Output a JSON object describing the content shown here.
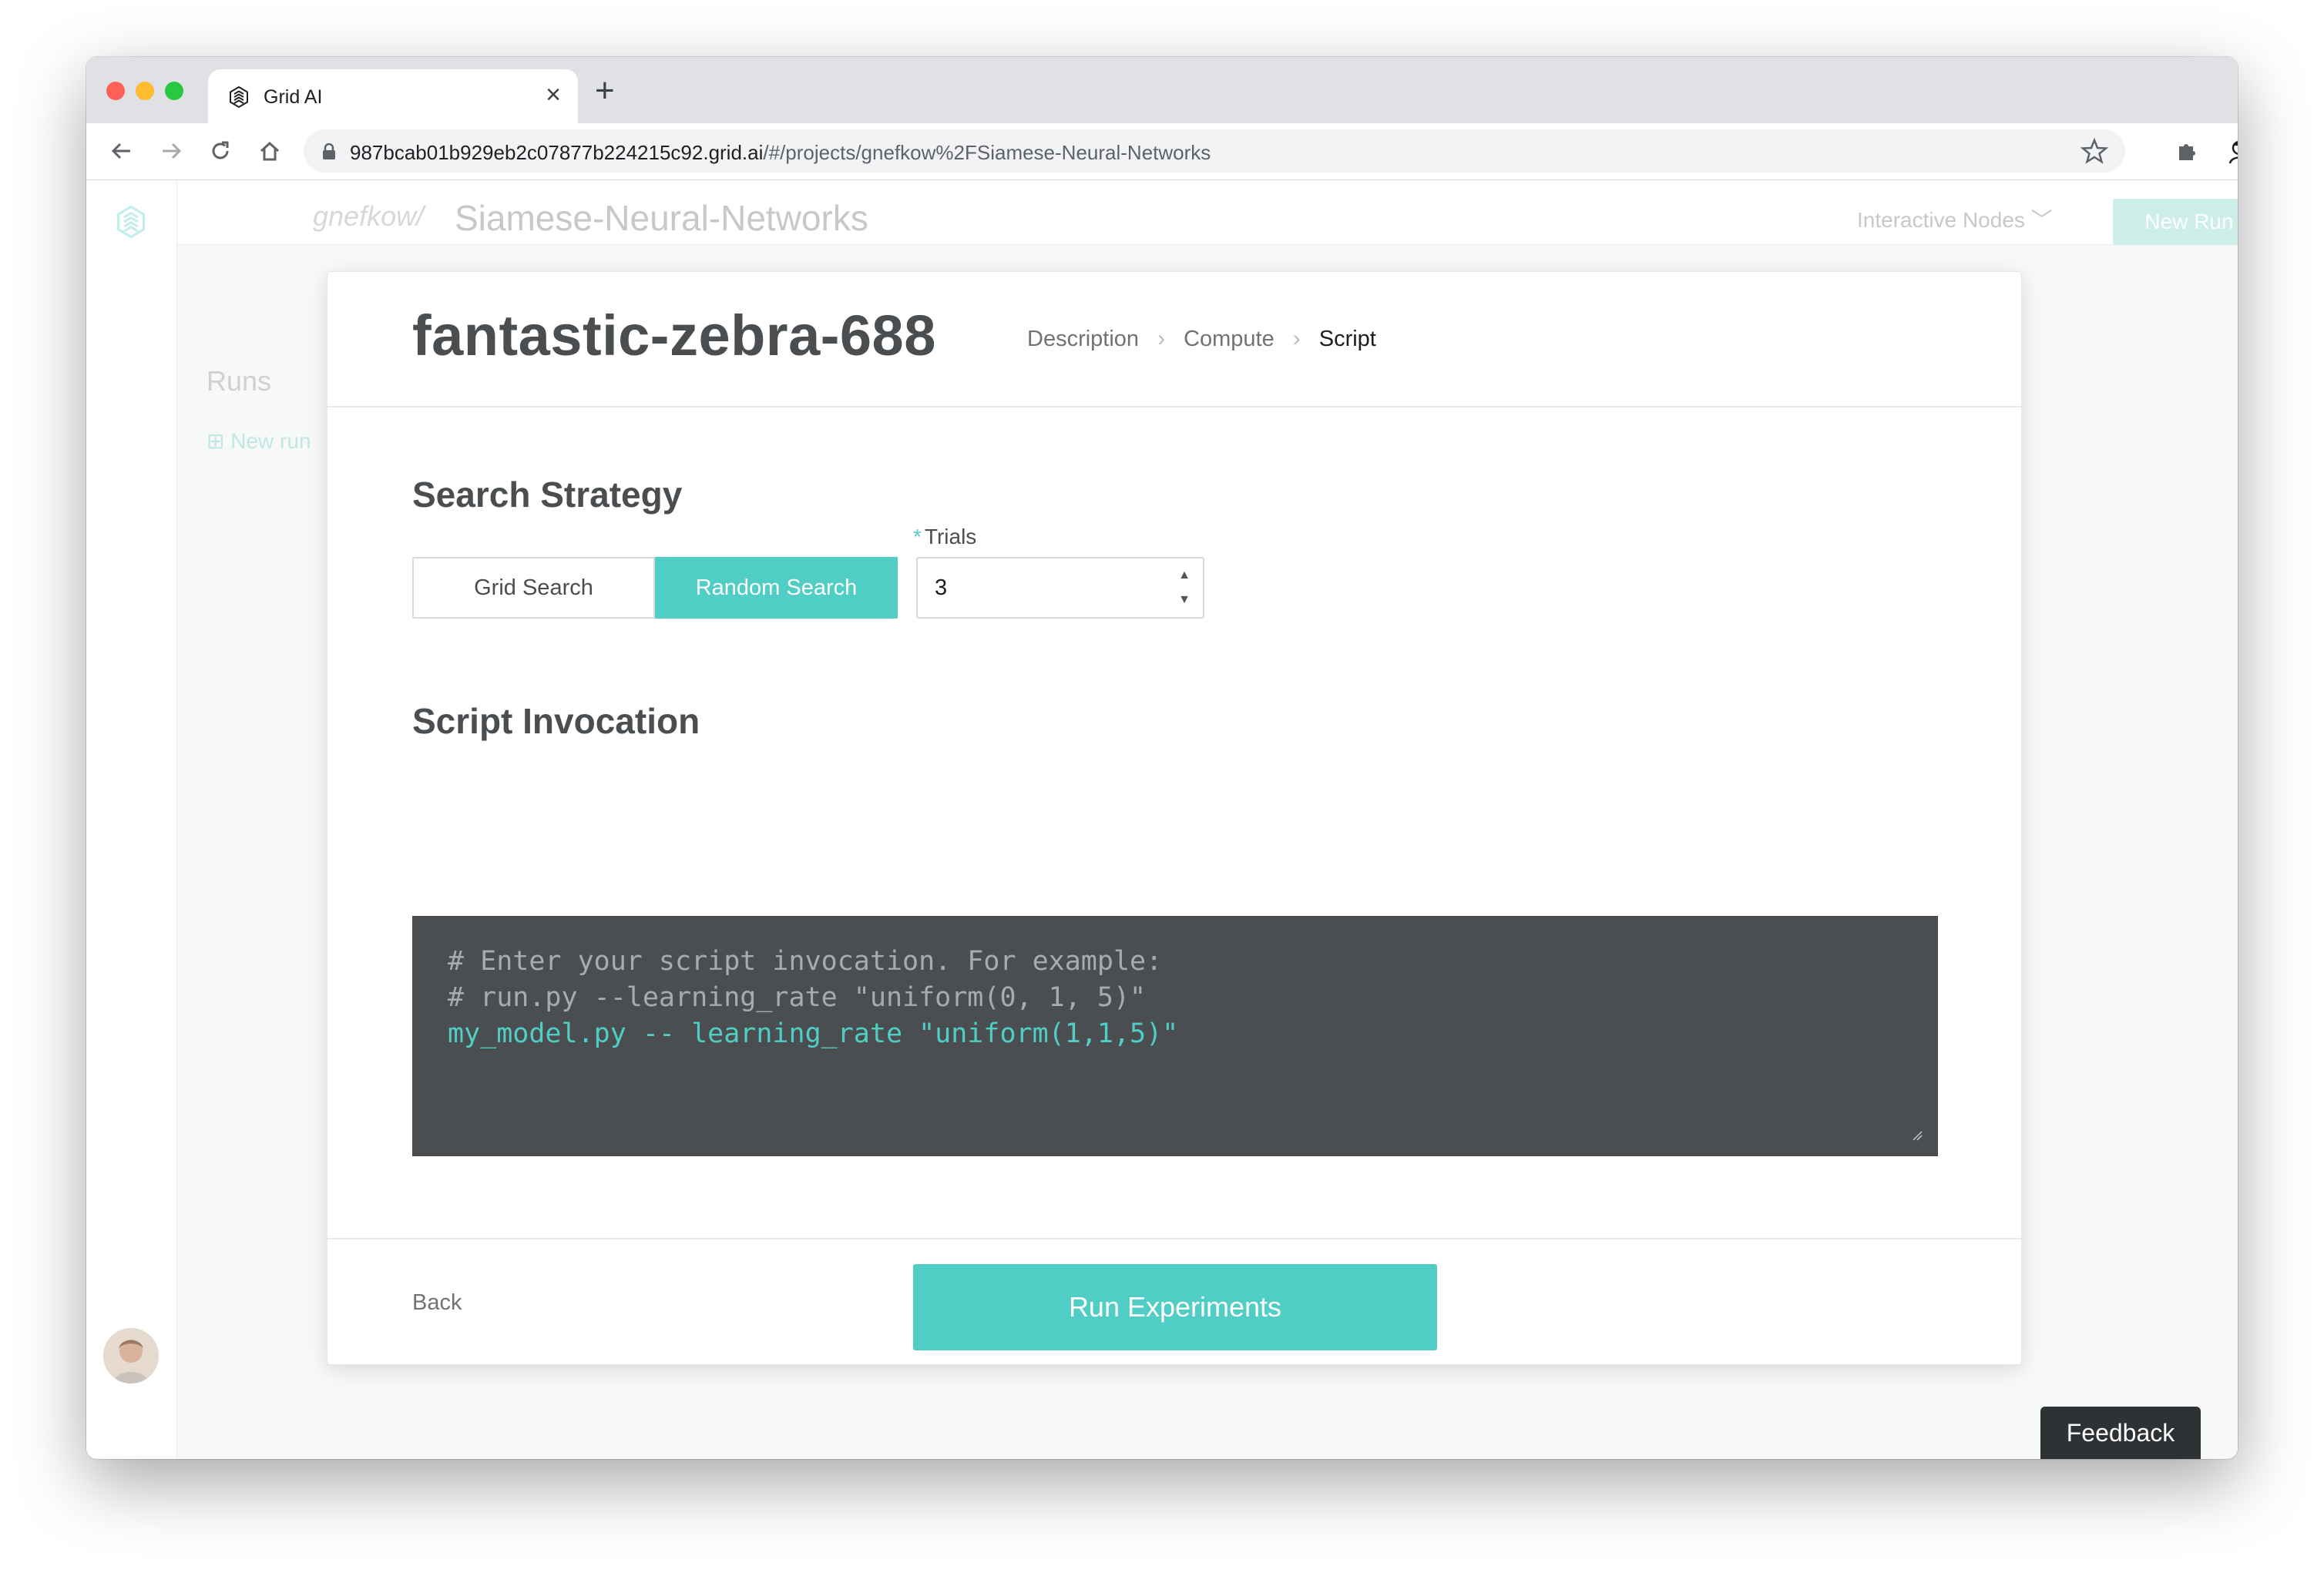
{
  "browser": {
    "tab_title": "Grid AI",
    "url_host": "987bcab01b929eb2c07877b224215c92.grid.ai",
    "url_path": "/#/projects/gnefkow%2FSiamese-Neural-Networks"
  },
  "page": {
    "breadcrumb_user": "gnefkow/",
    "project_name": "Siamese-Neural-Networks",
    "interactive_nodes": "Interactive Nodes",
    "new_run_button": "New Run",
    "runs_title": "Runs",
    "new_run_link": "New run",
    "feedback": "Feedback"
  },
  "modal": {
    "run_name": "fantastic-zebra-688",
    "steps": [
      "Description",
      "Compute",
      "Script"
    ],
    "active_step": "Script",
    "search_strategy": {
      "title": "Search Strategy",
      "options": [
        "Grid Search",
        "Random Search"
      ],
      "selected": "Random Search"
    },
    "trials": {
      "label": "Trials",
      "value": "3"
    },
    "script": {
      "title": "Script Invocation",
      "lines": [
        "# Enter your script invocation. For example:",
        "# run.py --learning_rate \"uniform(0, 1, 5)\"",
        "my_model.py -- learning_rate \"uniform(1,1,5)\""
      ]
    },
    "back": "Back",
    "run_button": "Run Experiments"
  },
  "colors": {
    "accent": "#50cdc4",
    "code_bg": "#4a4e51",
    "text": "#4a4e51"
  }
}
